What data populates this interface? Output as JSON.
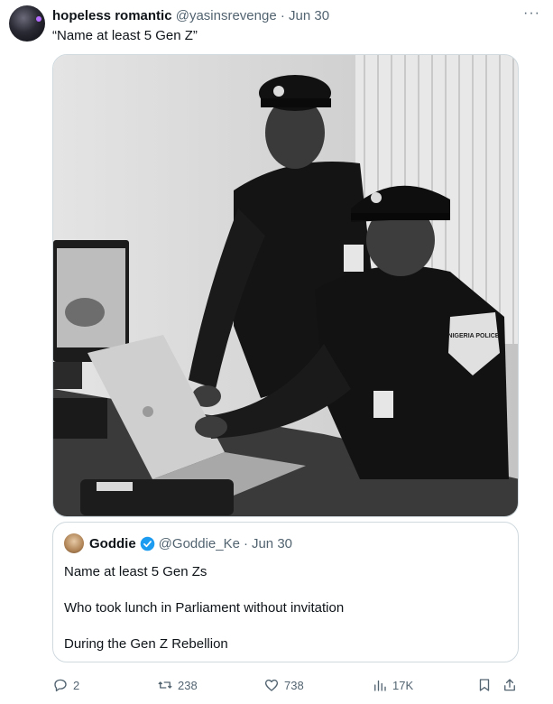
{
  "tweet": {
    "author_name": "hopeless romantic",
    "handle": "@yasinsrevenge",
    "separator": "·",
    "date": "Jun 30",
    "more_icon": "more-horizontal-icon",
    "text": "“Name at least 5 Gen Z”"
  },
  "media": {
    "badge_text": "NIGERIA POLICE"
  },
  "quote": {
    "author_name": "Goddie",
    "handle": "@Goddie_Ke",
    "separator": "·",
    "date": "Jun 30",
    "lines": [
      "Name at least 5 Gen Zs",
      "Who took lunch in Parliament without invitation",
      "During the Gen Z Rebellion"
    ]
  },
  "actions": {
    "reply_count": "2",
    "repost_count": "238",
    "like_count": "738",
    "views_count": "17K"
  },
  "colors": {
    "text_primary": "#0f1419",
    "text_secondary": "#536471",
    "border": "#cfd9de",
    "verified": "#1d9bf0"
  }
}
